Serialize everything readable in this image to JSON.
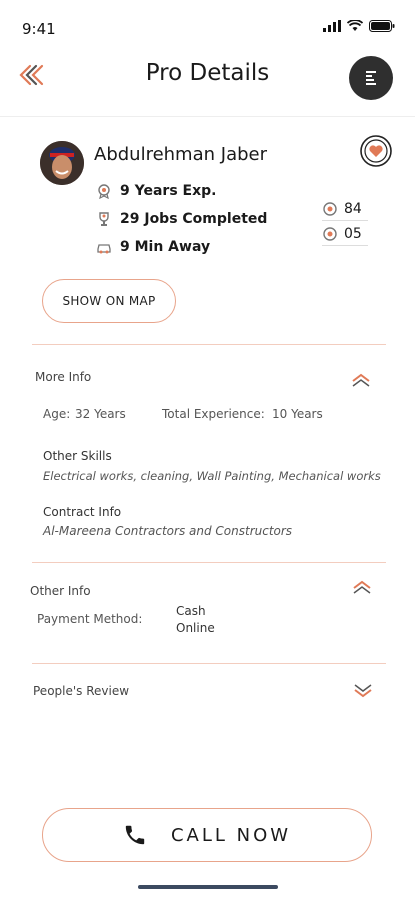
{
  "status": {
    "time": "9:41"
  },
  "header": {
    "title": "Pro Details"
  },
  "pro": {
    "name": "Abdulrehman Jaber",
    "experience": "9 Years Exp.",
    "jobs": "29 Jobs Completed",
    "distance": "9 Min Away",
    "side_stats": [
      "84",
      "05"
    ]
  },
  "actions": {
    "show_on_map": "SHOW ON MAP",
    "call_now": "CALL NOW"
  },
  "more_info": {
    "title": "More Info",
    "age_label": "Age:",
    "age_value": "32 Years",
    "exp_label": "Total Experience:",
    "exp_value": "10 Years",
    "skills_label": "Other Skills",
    "skills_value": "Electrical works, cleaning, Wall Painting, Mechanical works",
    "contract_label": "Contract Info",
    "contract_value": "Al-Mareena Contractors and Constructors"
  },
  "other_info": {
    "title": "Other Info",
    "payment_label": "Payment Method:",
    "payment_values": [
      "Cash",
      "Online"
    ]
  },
  "reviews": {
    "title": "People's Review"
  },
  "colors": {
    "accent": "#e07a57",
    "border": "#e8a48b",
    "dark": "#2f2f2f"
  }
}
